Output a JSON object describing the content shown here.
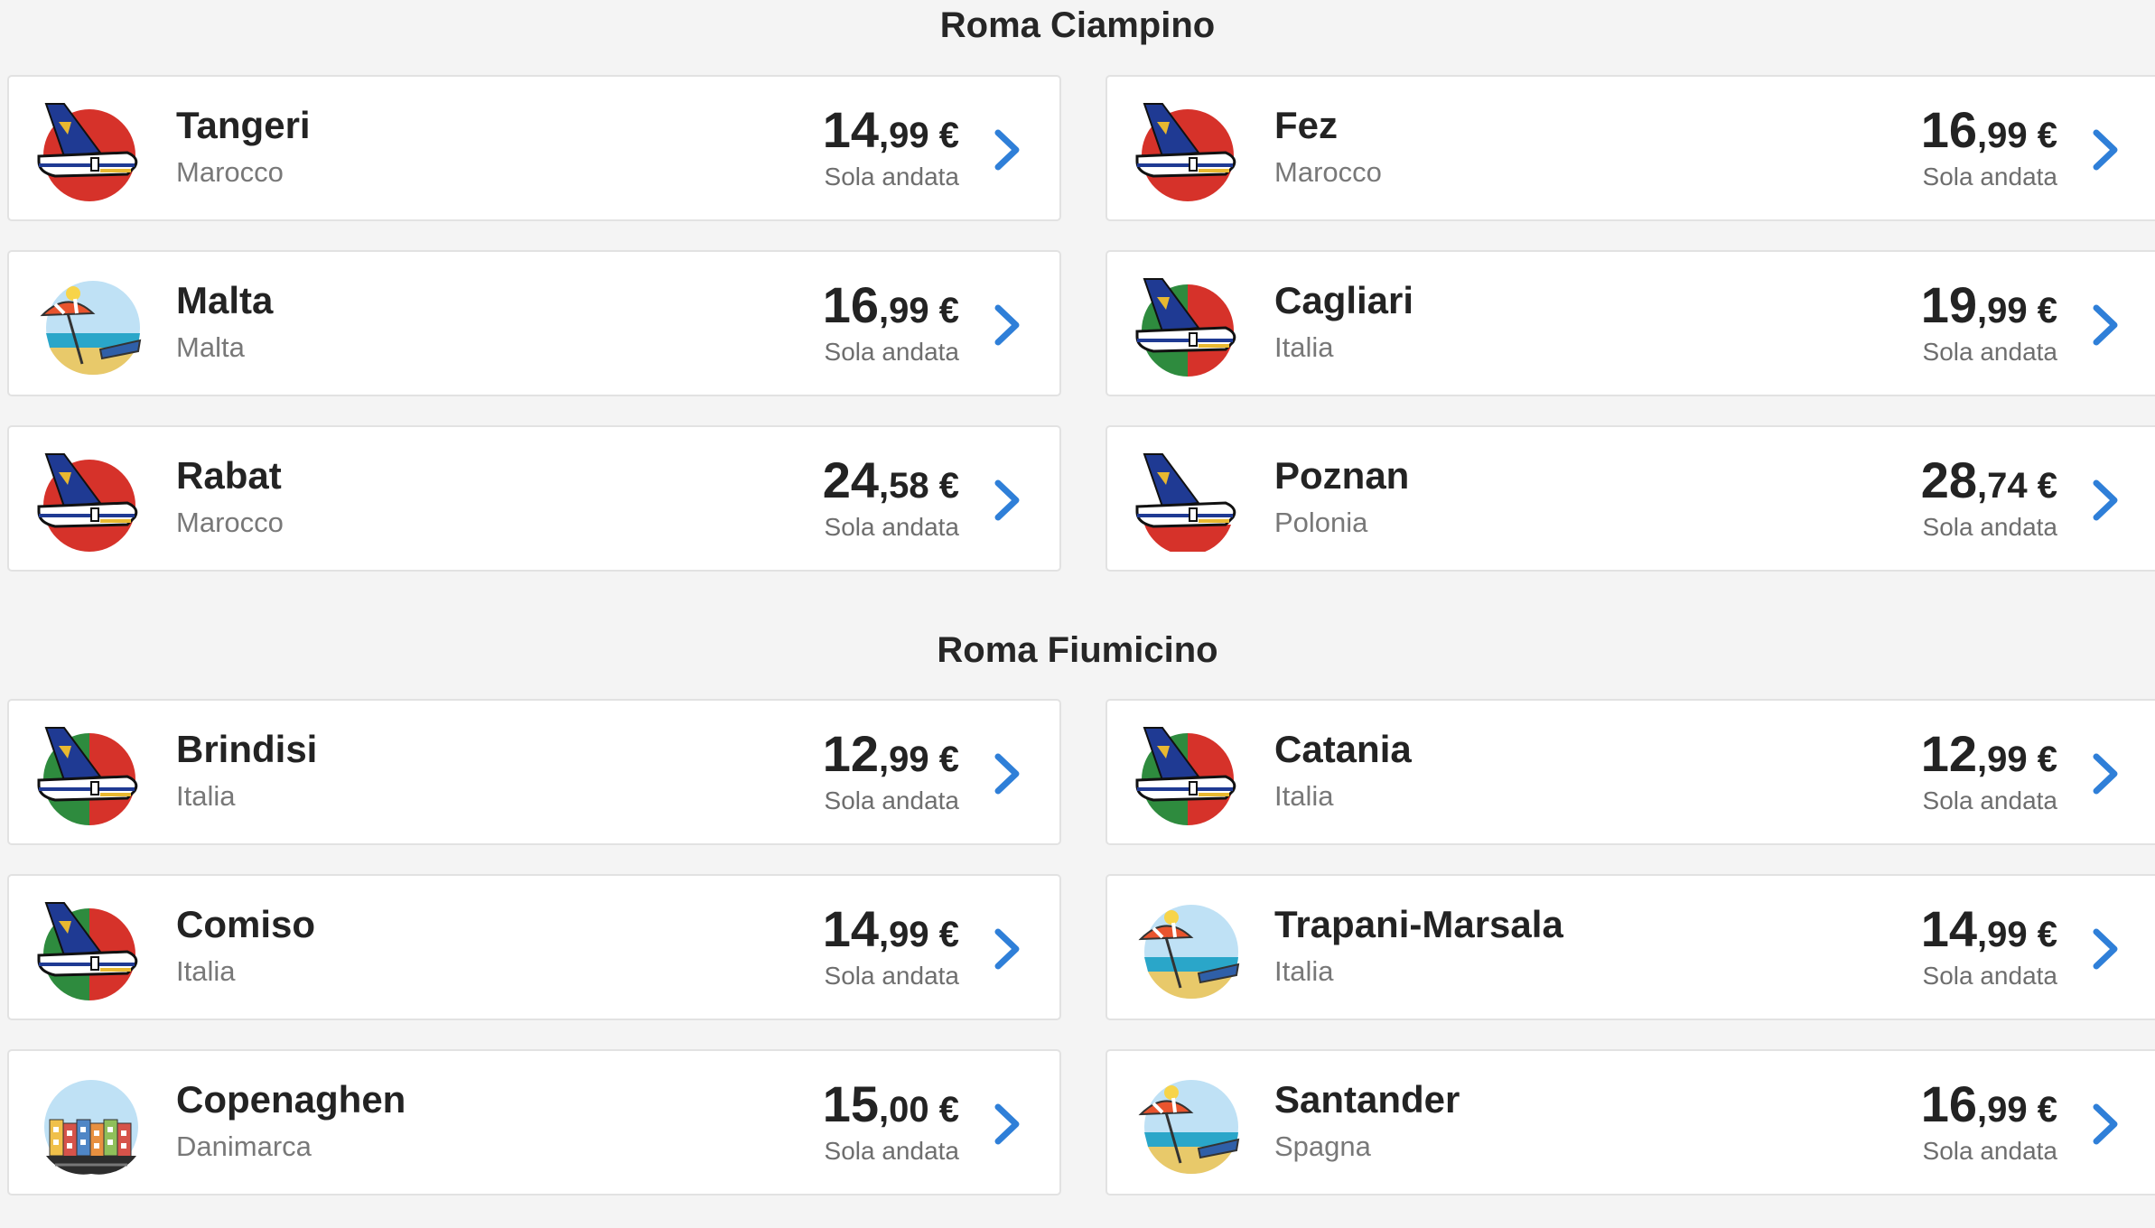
{
  "sections": [
    {
      "title": "Roma Ciampino",
      "cards": [
        {
          "city": "Tangeri",
          "country": "Marocco",
          "price_int": "14",
          "price_dec": ",99",
          "currency": " €",
          "fare": "Sola andata",
          "icon": "morocco-flag-plane-icon"
        },
        {
          "city": "Fez",
          "country": "Marocco",
          "price_int": "16",
          "price_dec": ",99",
          "currency": " €",
          "fare": "Sola andata",
          "icon": "morocco-flag-plane-icon"
        },
        {
          "city": "Malta",
          "country": "Malta",
          "price_int": "16",
          "price_dec": ",99",
          "currency": " €",
          "fare": "Sola andata",
          "icon": "beach-umbrella-icon"
        },
        {
          "city": "Cagliari",
          "country": "Italia",
          "price_int": "19",
          "price_dec": ",99",
          "currency": " €",
          "fare": "Sola andata",
          "icon": "italy-flag-plane-icon"
        },
        {
          "city": "Rabat",
          "country": "Marocco",
          "price_int": "24",
          "price_dec": ",58",
          "currency": " €",
          "fare": "Sola andata",
          "icon": "morocco-flag-plane-icon"
        },
        {
          "city": "Poznan",
          "country": "Polonia",
          "price_int": "28",
          "price_dec": ",74",
          "currency": " €",
          "fare": "Sola andata",
          "icon": "poland-flag-plane-icon"
        }
      ]
    },
    {
      "title": "Roma Fiumicino",
      "cards": [
        {
          "city": "Brindisi",
          "country": "Italia",
          "price_int": "12",
          "price_dec": ",99",
          "currency": " €",
          "fare": "Sola andata",
          "icon": "italy-flag-plane-icon"
        },
        {
          "city": "Catania",
          "country": "Italia",
          "price_int": "12",
          "price_dec": ",99",
          "currency": " €",
          "fare": "Sola andata",
          "icon": "italy-flag-plane-icon"
        },
        {
          "city": "Comiso",
          "country": "Italia",
          "price_int": "14",
          "price_dec": ",99",
          "currency": " €",
          "fare": "Sola andata",
          "icon": "italy-flag-plane-icon"
        },
        {
          "city": "Trapani-Marsala",
          "country": "Italia",
          "price_int": "14",
          "price_dec": ",99",
          "currency": " €",
          "fare": "Sola andata",
          "icon": "beach-umbrella-icon"
        },
        {
          "city": "Copenaghen",
          "country": "Danimarca",
          "price_int": "15",
          "price_dec": ",00",
          "currency": " €",
          "fare": "Sola andata",
          "icon": "city-houses-icon"
        },
        {
          "city": "Santander",
          "country": "Spagna",
          "price_int": "16",
          "price_dec": ",99",
          "currency": " €",
          "fare": "Sola andata",
          "icon": "beach-umbrella-icon"
        }
      ]
    }
  ],
  "colors": {
    "chevron": "#2f7fd8",
    "plane_tail": "#1f3a93",
    "plane_logo": "#e8b830",
    "morocco_red": "#d6322a",
    "morocco_star": "#2e7d32",
    "italy_green": "#2e8b3e",
    "italy_red": "#d6322a",
    "poland_red": "#d6322a"
  }
}
